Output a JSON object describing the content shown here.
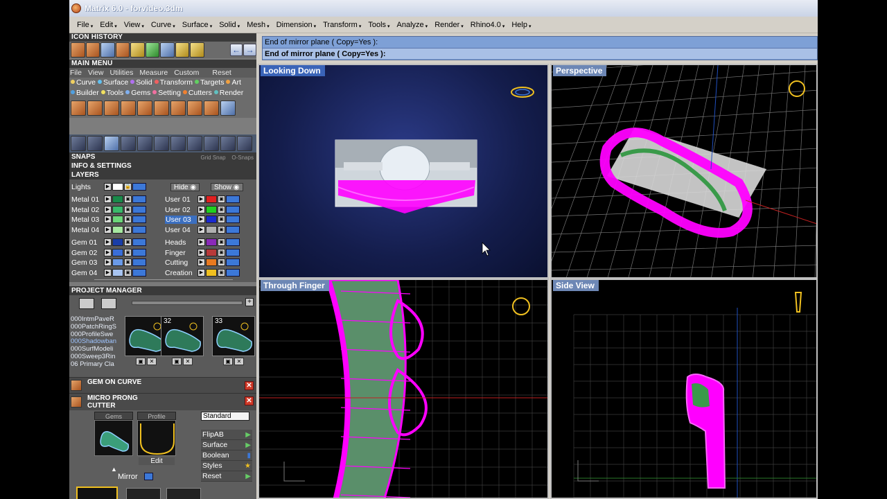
{
  "window": {
    "title": "Matrix 6.0 - forvideo.3dm"
  },
  "menubar": [
    "File",
    "Edit",
    "View",
    "Curve",
    "Surface",
    "Solid",
    "Mesh",
    "Dimension",
    "Transform",
    "Tools",
    "Analyze",
    "Render",
    "Rhino4.0",
    "Help"
  ],
  "icon_history": {
    "title": "ICON HISTORY"
  },
  "main_menu": {
    "title": "MAIN MENU",
    "menu": [
      "File",
      "View",
      "Utilities",
      "Measure",
      "Custom"
    ],
    "reset": "Reset",
    "tabs_row1": [
      {
        "label": "Curve",
        "color": "#f0d060"
      },
      {
        "label": "Surface",
        "color": "#60c0f0"
      },
      {
        "label": "Solid",
        "color": "#b070f0"
      },
      {
        "label": "Transform",
        "color": "#f06060"
      },
      {
        "label": "Targets",
        "color": "#60d060"
      },
      {
        "label": "Art",
        "color": "#f0a040"
      }
    ],
    "tabs_row2": [
      {
        "label": "Builder",
        "color": "#50a0e0"
      },
      {
        "label": "Tools",
        "color": "#f0e060"
      },
      {
        "label": "Gems",
        "color": "#80b0f0"
      },
      {
        "label": "Setting",
        "color": "#f070a0"
      },
      {
        "label": "Cutters",
        "color": "#f08030"
      },
      {
        "label": "Render",
        "color": "#60c0c0"
      }
    ]
  },
  "snaps": {
    "title": "SNAPS",
    "grid_snap": "Grid Snap",
    "osnaps": "O-Snaps"
  },
  "info_settings": {
    "title": "INFO & SETTINGS"
  },
  "layers": {
    "title": "LAYERS",
    "lights": "Lights",
    "hide": "Hide",
    "show": "Show",
    "left": [
      {
        "name": "Metal 01",
        "color": "#1a8a4a"
      },
      {
        "name": "Metal 02",
        "color": "#3ab86a"
      },
      {
        "name": "Metal 03",
        "color": "#6cd67a"
      },
      {
        "name": "Metal 04",
        "color": "#a6e8a0"
      },
      {
        "name": "Gem 01",
        "color": "#1a3ea8"
      },
      {
        "name": "Gem 02",
        "color": "#3a6ed8"
      },
      {
        "name": "Gem 03",
        "color": "#6a9ae8"
      },
      {
        "name": "Gem 04",
        "color": "#a8c4f0"
      }
    ],
    "right": [
      {
        "name": "User 01",
        "color": "#e02020"
      },
      {
        "name": "User 02",
        "color": "#20d020"
      },
      {
        "name": "User 03",
        "color": "#1a2ad0"
      },
      {
        "name": "User 04",
        "color": "#b0b0b0"
      },
      {
        "name": "Heads",
        "color": "#8a2ab8"
      },
      {
        "name": "Finger",
        "color": "#b83a3a"
      },
      {
        "name": "Cutting",
        "color": "#e87a20"
      },
      {
        "name": "Creation",
        "color": "#f0c020"
      }
    ]
  },
  "project_manager": {
    "title": "PROJECT MANAGER",
    "files": [
      "000IntmPaveR",
      "000PatchRingS",
      "000ProfileSwe",
      "000Shadowban",
      "000SurfModeli",
      "000Sweep3Rin",
      "06 Primary Cla"
    ],
    "thumbs": [
      "",
      "32",
      "33"
    ]
  },
  "gem_on_curve": {
    "title": "GEM ON CURVE"
  },
  "micro_prong": {
    "title_line1": "MICRO PRONG",
    "title_line2": "CUTTER",
    "gems_tab": "Gems",
    "profile_tab": "Profile",
    "edit": "Edit",
    "mirror": "Mirror",
    "dropdown": "Standard",
    "options": [
      "FlipAB",
      "Surface",
      "Boolean",
      "Styles",
      "Reset"
    ]
  },
  "command": {
    "line1": "End of mirror plane ( Copy=Yes ):",
    "line2": "End of mirror plane ( Copy=Yes ):"
  },
  "viewports": {
    "top_left": "Looking Down",
    "top_right": "Perspective",
    "bottom_left": "Through Finger",
    "bottom_right": "Side View"
  },
  "colors": {
    "accent": "#3a64b8",
    "magenta": "#ff00ff"
  }
}
